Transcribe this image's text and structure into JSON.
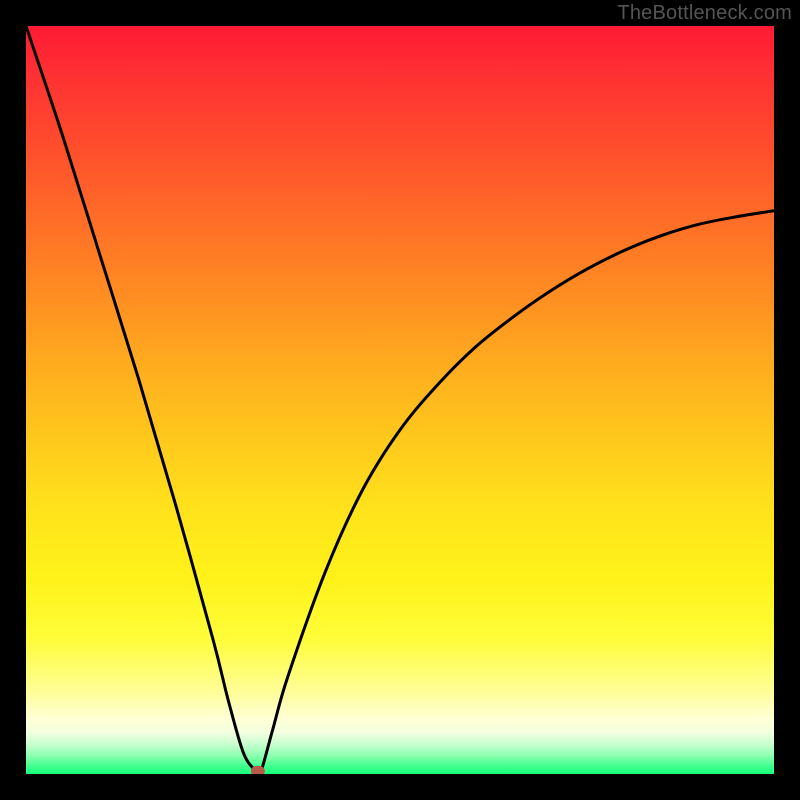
{
  "watermark": "TheBottleneck.com",
  "colors": {
    "frame": "#000000",
    "curve": "#000000",
    "marker": "#b85a4a"
  },
  "chart_data": {
    "type": "line",
    "title": "",
    "xlabel": "",
    "ylabel": "",
    "xlim": [
      0,
      100
    ],
    "ylim": [
      0,
      100
    ],
    "grid": false,
    "series": [
      {
        "name": "bottleneck-curve",
        "x": [
          0,
          5,
          10,
          15,
          20,
          25,
          27,
          29,
          30.5,
          31,
          31.5,
          33,
          35,
          40,
          45,
          50,
          55,
          60,
          65,
          70,
          75,
          80,
          85,
          90,
          95,
          100
        ],
        "values": [
          100,
          85,
          69,
          53,
          36,
          18,
          10,
          3,
          0.6,
          0.4,
          0.6,
          6,
          13,
          27,
          38,
          46,
          52,
          57,
          61,
          64.5,
          67.5,
          70,
          72,
          73.5,
          74.5,
          75.3
        ]
      }
    ],
    "annotations": [
      {
        "name": "min-marker",
        "x": 31,
        "y": 0.4,
        "shape": "rounded-rect"
      }
    ]
  }
}
